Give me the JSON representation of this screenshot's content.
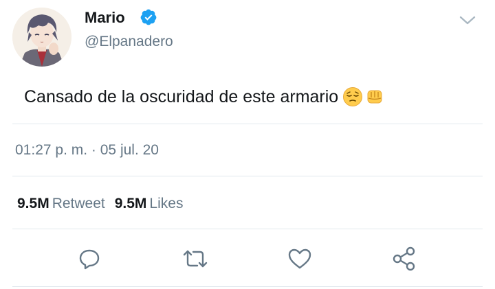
{
  "user": {
    "display_name": "Mario",
    "handle": "@Elpanadero",
    "verified": true
  },
  "tweet": {
    "text": "Cansado de la oscuridad de este armario",
    "emojis": [
      "pensive-face",
      "oncoming-fist"
    ]
  },
  "meta": {
    "time": "01:27 p. m.",
    "separator": "·",
    "date": "05 jul. 20"
  },
  "stats": {
    "retweets_count": "9.5M",
    "retweets_label": "Retweet",
    "likes_count": "9.5M",
    "likes_label": "Likes"
  },
  "actions": {
    "icons": [
      "reply-icon",
      "retweet-icon",
      "like-icon",
      "share-icon"
    ]
  },
  "colors": {
    "primary_text": "#14171a",
    "secondary_text": "#657786",
    "divider": "#e1e8ed",
    "verified_blue": "#1da1f2"
  }
}
